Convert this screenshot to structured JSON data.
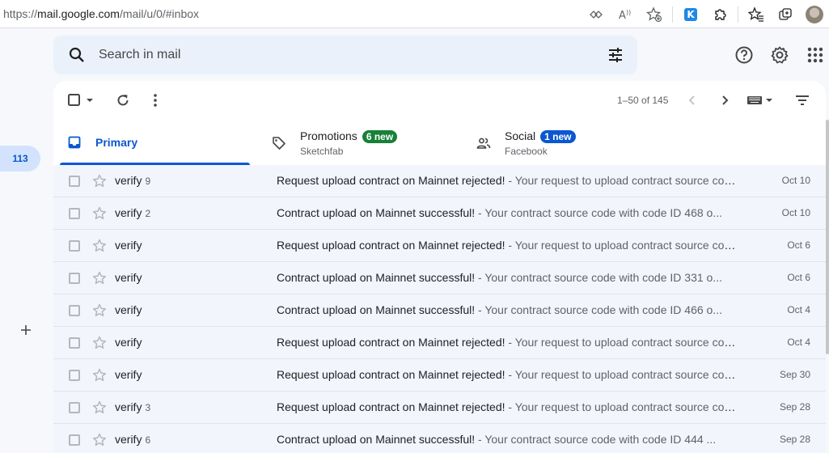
{
  "browser": {
    "url_scheme": "https://",
    "url_host": "mail.google.com",
    "url_path": "/mail/u/0/#inbox"
  },
  "search": {
    "placeholder": "Search in mail"
  },
  "leftrail": {
    "inbox_count": "113"
  },
  "toolbar": {
    "pager": "1–50 of 145"
  },
  "tabs": [
    {
      "name": "Primary",
      "selected": true
    },
    {
      "name": "Promotions",
      "badge": "6 new",
      "badge_color": "#188038",
      "sub": "Sketchfab"
    },
    {
      "name": "Social",
      "badge": "1 new",
      "badge_color": "#0b57d0",
      "sub": "Facebook"
    }
  ],
  "emails": [
    {
      "sender": "verify",
      "count": "9",
      "subject": "Request upload contract on Mainnet rejected!",
      "snippet": " - Your request to upload contract source code with code ID",
      "date": "Oct 10"
    },
    {
      "sender": "verify",
      "count": "2",
      "subject": "Contract upload on Mainnet successful!",
      "snippet": " - Your contract source code with code ID 468 o...",
      "date": "Oct 10"
    },
    {
      "sender": "verify",
      "count": "",
      "subject": "Request upload contract on Mainnet rejected!",
      "snippet": " - Your request to upload contract source code with code ID",
      "date": "Oct 6"
    },
    {
      "sender": "verify",
      "count": "",
      "subject": "Contract upload on Mainnet successful!",
      "snippet": " - Your contract source code with code ID 331 o...",
      "date": "Oct 6"
    },
    {
      "sender": "verify",
      "count": "",
      "subject": "Contract upload on Mainnet successful!",
      "snippet": " - Your contract source code with code ID 466 o...",
      "date": "Oct 4"
    },
    {
      "sender": "verify",
      "count": "",
      "subject": "Request upload contract on Mainnet rejected!",
      "snippet": " - Your request to upload contract source code with code ID",
      "date": "Oct 4"
    },
    {
      "sender": "verify",
      "count": "",
      "subject": "Request upload contract on Mainnet rejected!",
      "snippet": " - Your request to upload contract source code with code ID",
      "date": "Sep 30"
    },
    {
      "sender": "verify",
      "count": "3",
      "subject": "Request upload contract on Mainnet rejected!",
      "snippet": " - Your request to upload contract source code with code ID",
      "date": "Sep 28"
    },
    {
      "sender": "verify",
      "count": "6",
      "subject": "Contract upload on Mainnet successful!",
      "snippet": " - Your contract source code with code ID 444 ...",
      "date": "Sep 28"
    }
  ],
  "colors": {
    "accent": "#0b57d0",
    "row_bg": "#f2f6fc",
    "search_bg": "#eaf1fb"
  }
}
